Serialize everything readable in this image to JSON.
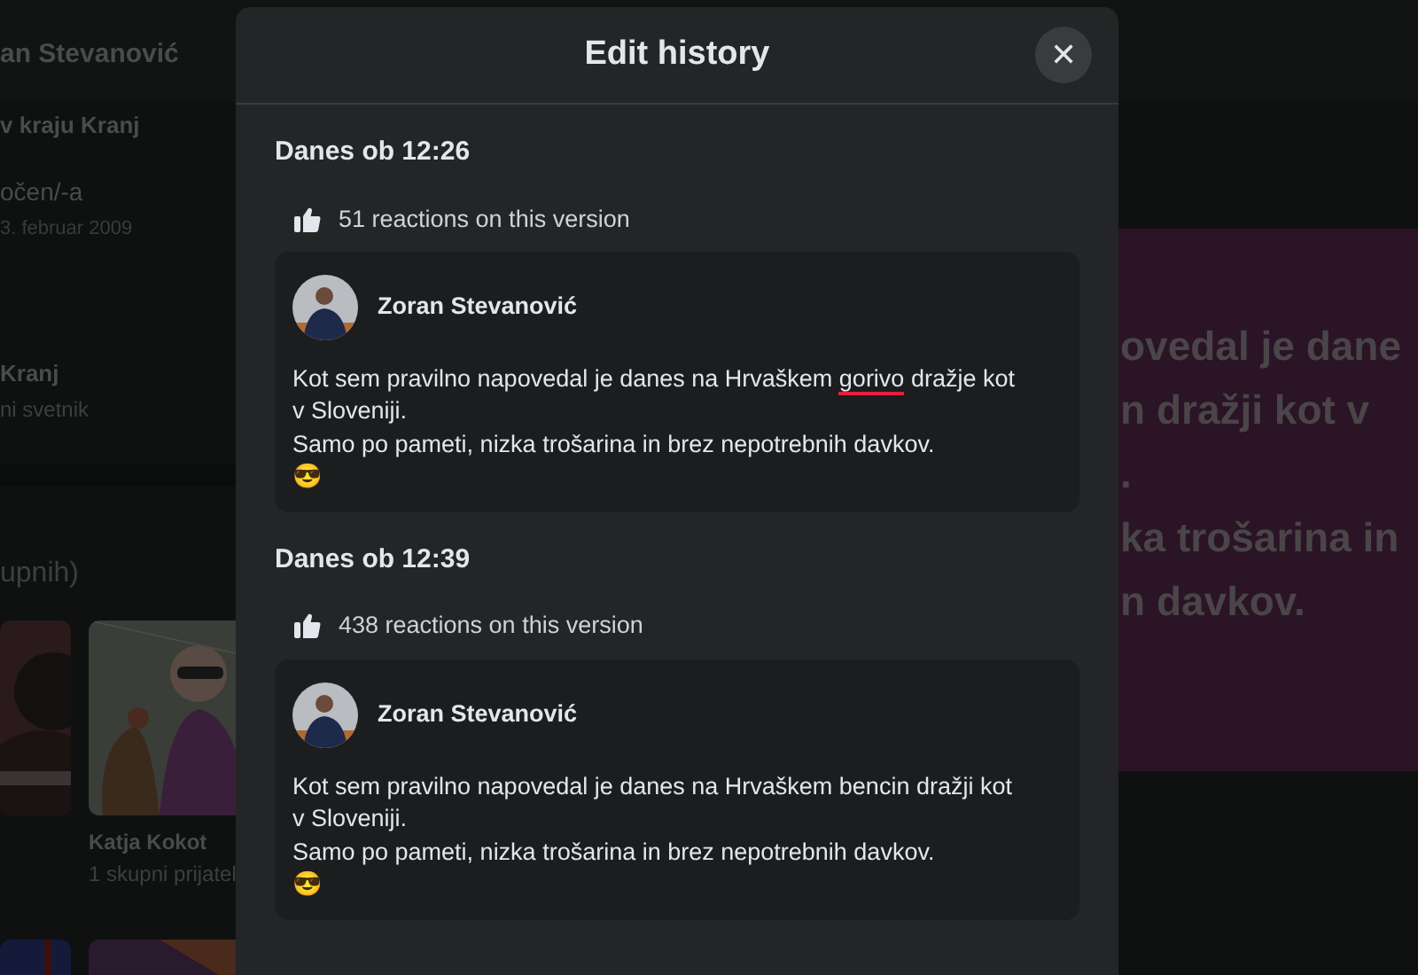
{
  "background": {
    "profile_name": "an Stevanović",
    "location": "v kraju Kranj",
    "relationship": "očen/-a",
    "relationship_date": "3. februar 2009",
    "work_place": "Kranj",
    "work_role": "ni svetnik",
    "friends_heading": "upnih)",
    "friends": [
      {
        "kind": "picture"
      },
      {
        "kind": "picture",
        "name": "Katja Kokot",
        "mutual": "1 skupni prijatel"
      }
    ],
    "post_lines": [
      "ovedal je dane",
      "n dražji kot v",
      ".",
      "ka trošarina in",
      "n davkov."
    ]
  },
  "dialog": {
    "title": "Edit history",
    "close_label": "✕",
    "versions": [
      {
        "date": "Danes ob 12:26",
        "reactions": "51 reactions on this version",
        "author": "Zoran Stevanović",
        "paragraphs": [
          [
            {
              "text": "Kot sem pravilno napovedal je danes na Hrvaškem "
            },
            {
              "text": "gorivo",
              "changed": true
            },
            {
              "text": " dražje kot v Sloveniji."
            }
          ],
          [
            {
              "text": "Samo po pameti, nizka trošarina in brez nepotrebnih davkov."
            }
          ],
          [
            {
              "text": "😎"
            }
          ]
        ]
      },
      {
        "date": "Danes ob 12:39",
        "reactions": "438 reactions on this version",
        "author": "Zoran Stevanović",
        "paragraphs": [
          [
            {
              "text": "Kot sem pravilno napovedal je danes na Hrvaškem bencin dražji kot v Sloveniji."
            }
          ],
          [
            {
              "text": "Samo po pameti, nizka trošarina in brez nepotrebnih davkov."
            }
          ],
          [
            {
              "text": "😎"
            }
          ]
        ]
      }
    ]
  }
}
